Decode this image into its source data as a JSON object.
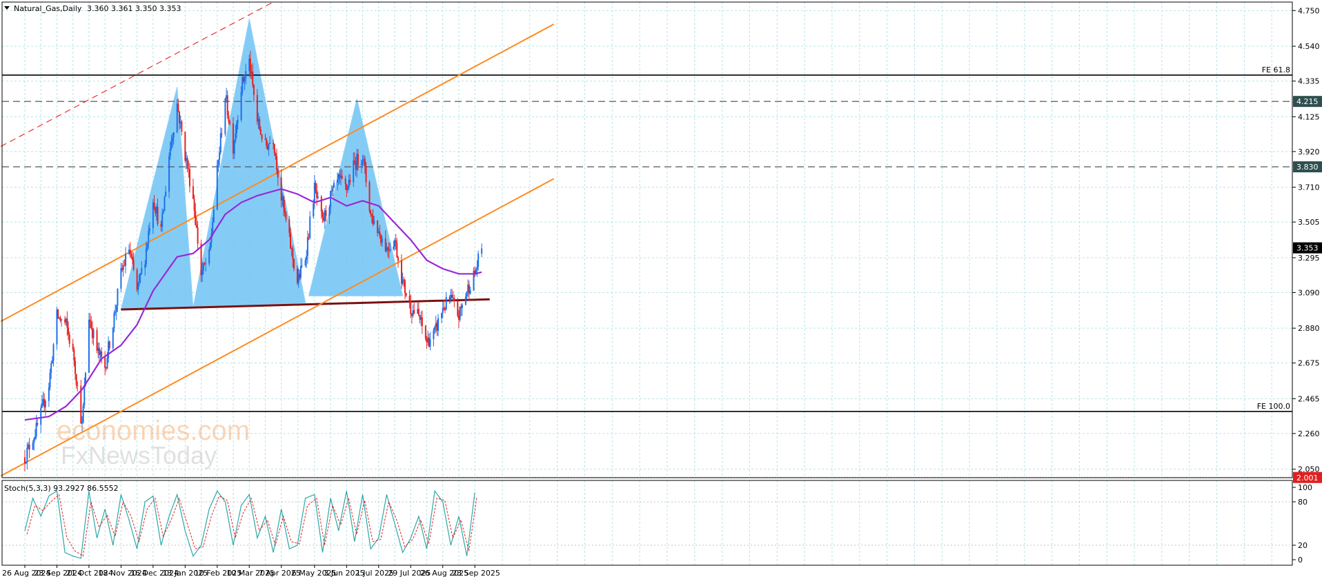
{
  "header": {
    "symbol": "Natural_Gas,Daily",
    "ohlc": "3.360 3.361 3.350 3.353"
  },
  "watermark": {
    "line1": "economies.com",
    "line2": "FxNewsToday"
  },
  "chart_data": {
    "type": "candlestick",
    "price_axis": {
      "ticks": [
        "4.750",
        "4.540",
        "4.335",
        "4.125",
        "3.920",
        "3.710",
        "3.505",
        "3.295",
        "3.090",
        "2.880",
        "2.675",
        "2.465",
        "2.260",
        "2.050"
      ],
      "ylim": [
        2.0,
        4.8
      ]
    },
    "price_tags": [
      {
        "label": "4.215",
        "price": 4.215,
        "style": "dark"
      },
      {
        "label": "3.830",
        "price": 3.83,
        "style": "dark"
      },
      {
        "label": "3.353",
        "price": 3.353,
        "style": "black"
      },
      {
        "label": "2.001",
        "price": 2.001,
        "style": "red"
      }
    ],
    "fib_labels": [
      {
        "label": "FE 61.8",
        "price": 4.37
      },
      {
        "label": "FE 100.0",
        "price": 2.39
      }
    ],
    "date_ticks": [
      {
        "label": "26 Aug 2024",
        "date": "2024-08-26"
      },
      {
        "label": "23 Sep 2024",
        "date": "2024-09-23"
      },
      {
        "label": "21 Oct 2024",
        "date": "2024-10-21"
      },
      {
        "label": "18 Nov 2024",
        "date": "2024-11-18"
      },
      {
        "label": "16 Dec 2024",
        "date": "2024-12-16"
      },
      {
        "label": "13 Jan 2025",
        "date": "2025-01-13"
      },
      {
        "label": "10 Feb 2025",
        "date": "2025-02-10"
      },
      {
        "label": "10 Mar 2025",
        "date": "2025-03-10"
      },
      {
        "label": "7 Apr 2025",
        "date": "2025-04-07"
      },
      {
        "label": "6 May 2025",
        "date": "2025-05-06"
      },
      {
        "label": "3 Jun 2025",
        "date": "2025-06-03"
      },
      {
        "label": "1 Jul 2025",
        "date": "2025-07-01"
      },
      {
        "label": "29 Jul 2025",
        "date": "2025-07-29"
      },
      {
        "label": "26 Aug 2025",
        "date": "2025-08-26"
      },
      {
        "label": "23 Sep 2025",
        "date": "2025-09-23"
      }
    ],
    "close_path": [
      [
        "2024-08-26",
        2.12
      ],
      [
        "2024-09-06",
        2.3
      ],
      [
        "2024-09-16",
        2.55
      ],
      [
        "2024-09-23",
        2.95
      ],
      [
        "2024-10-01",
        2.9
      ],
      [
        "2024-10-08",
        2.7
      ],
      [
        "2024-10-15",
        2.3
      ],
      [
        "2024-10-21",
        2.95
      ],
      [
        "2024-10-28",
        2.75
      ],
      [
        "2024-11-04",
        2.65
      ],
      [
        "2024-11-12",
        2.95
      ],
      [
        "2024-11-18",
        3.2
      ],
      [
        "2024-11-25",
        3.35
      ],
      [
        "2024-12-02",
        3.1
      ],
      [
        "2024-12-09",
        3.3
      ],
      [
        "2024-12-16",
        3.65
      ],
      [
        "2024-12-23",
        3.45
      ],
      [
        "2024-12-30",
        3.9
      ],
      [
        "2025-01-06",
        4.2
      ],
      [
        "2025-01-13",
        3.9
      ],
      [
        "2025-01-20",
        3.65
      ],
      [
        "2025-01-27",
        3.2
      ],
      [
        "2025-02-03",
        3.3
      ],
      [
        "2025-02-10",
        3.8
      ],
      [
        "2025-02-17",
        4.25
      ],
      [
        "2025-02-24",
        3.95
      ],
      [
        "2025-03-03",
        4.3
      ],
      [
        "2025-03-10",
        4.45
      ],
      [
        "2025-03-17",
        4.1
      ],
      [
        "2025-03-24",
        3.95
      ],
      [
        "2025-03-31",
        4.0
      ],
      [
        "2025-04-07",
        3.65
      ],
      [
        "2025-04-14",
        3.4
      ],
      [
        "2025-04-21",
        3.15
      ],
      [
        "2025-04-28",
        3.3
      ],
      [
        "2025-05-06",
        3.7
      ],
      [
        "2025-05-13",
        3.5
      ],
      [
        "2025-05-20",
        3.65
      ],
      [
        "2025-05-27",
        3.75
      ],
      [
        "2025-06-03",
        3.7
      ],
      [
        "2025-06-10",
        3.85
      ],
      [
        "2025-06-17",
        3.9
      ],
      [
        "2025-06-24",
        3.55
      ],
      [
        "2025-07-01",
        3.45
      ],
      [
        "2025-07-08",
        3.35
      ],
      [
        "2025-07-15",
        3.4
      ],
      [
        "2025-07-22",
        3.15
      ],
      [
        "2025-07-29",
        3.0
      ],
      [
        "2025-08-05",
        2.95
      ],
      [
        "2025-08-12",
        2.8
      ],
      [
        "2025-08-19",
        2.85
      ],
      [
        "2025-08-26",
        3.0
      ],
      [
        "2025-09-02",
        3.05
      ],
      [
        "2025-09-09",
        2.95
      ],
      [
        "2025-09-16",
        3.1
      ],
      [
        "2025-09-23",
        3.2
      ],
      [
        "2025-09-29",
        3.35
      ]
    ],
    "moving_average": [
      [
        "2024-08-26",
        2.34
      ],
      [
        "2024-09-16",
        2.36
      ],
      [
        "2024-10-01",
        2.42
      ],
      [
        "2024-10-15",
        2.52
      ],
      [
        "2024-11-01",
        2.7
      ],
      [
        "2024-11-18",
        2.78
      ],
      [
        "2024-12-02",
        2.9
      ],
      [
        "2024-12-16",
        3.1
      ],
      [
        "2025-01-06",
        3.3
      ],
      [
        "2025-01-20",
        3.32
      ],
      [
        "2025-02-03",
        3.4
      ],
      [
        "2025-02-17",
        3.55
      ],
      [
        "2025-03-03",
        3.62
      ],
      [
        "2025-03-17",
        3.66
      ],
      [
        "2025-04-07",
        3.7
      ],
      [
        "2025-04-21",
        3.67
      ],
      [
        "2025-05-06",
        3.62
      ],
      [
        "2025-05-20",
        3.65
      ],
      [
        "2025-06-03",
        3.6
      ],
      [
        "2025-06-17",
        3.63
      ],
      [
        "2025-07-01",
        3.6
      ],
      [
        "2025-07-15",
        3.5
      ],
      [
        "2025-07-29",
        3.4
      ],
      [
        "2025-08-12",
        3.28
      ],
      [
        "2025-08-26",
        3.23
      ],
      [
        "2025-09-09",
        3.2
      ],
      [
        "2025-09-23",
        3.2
      ],
      [
        "2025-09-29",
        3.21
      ]
    ],
    "neckline": [
      [
        "2024-11-18",
        2.99
      ],
      [
        "2025-10-06",
        3.05
      ]
    ],
    "horizontal_levels": [
      {
        "price": 4.37,
        "style": "solid"
      },
      {
        "price": 4.215,
        "style": "dashed"
      },
      {
        "price": 3.83,
        "style": "dashed"
      },
      {
        "price": 2.39,
        "style": "solid"
      },
      {
        "price": 2.001,
        "style": "red-dotted"
      }
    ],
    "trend_lines": [
      {
        "style": "orange",
        "from": [
          "2024-08-05",
          2.92
        ],
        "to": [
          "2025-12-01",
          4.67
        ]
      },
      {
        "style": "orange",
        "from": [
          "2024-08-05",
          2.01
        ],
        "to": [
          "2025-12-01",
          3.76
        ]
      },
      {
        "style": "red-dashed",
        "from": [
          "2024-08-05",
          3.95
        ],
        "to": [
          "2025-03-31",
          4.8
        ]
      }
    ],
    "patterns": [
      {
        "name": "left shoulder",
        "points": [
          [
            "2024-11-18",
            2.99
          ],
          [
            "2025-01-06",
            4.3
          ],
          [
            "2025-01-20",
            3.0
          ]
        ]
      },
      {
        "name": "head",
        "points": [
          [
            "2025-01-20",
            3.0
          ],
          [
            "2025-03-10",
            4.7
          ],
          [
            "2025-04-28",
            3.03
          ]
        ]
      },
      {
        "name": "right shoulder",
        "points": [
          [
            "2025-05-01",
            3.07
          ],
          [
            "2025-06-12",
            4.23
          ],
          [
            "2025-07-22",
            3.07
          ]
        ]
      }
    ],
    "stochastic": {
      "label": "Stoch(5,3,3) 93.2927 86.5552",
      "scale_ticks": [
        "100",
        "80",
        "20",
        "0"
      ],
      "ylim": [
        0,
        100
      ],
      "k": [
        [
          "2024-08-26",
          40
        ],
        [
          "2024-09-02",
          85
        ],
        [
          "2024-09-09",
          60
        ],
        [
          "2024-09-16",
          88
        ],
        [
          "2024-09-23",
          95
        ],
        [
          "2024-09-30",
          10
        ],
        [
          "2024-10-07",
          5
        ],
        [
          "2024-10-14",
          2
        ],
        [
          "2024-10-21",
          95
        ],
        [
          "2024-10-28",
          30
        ],
        [
          "2024-11-04",
          70
        ],
        [
          "2024-11-11",
          20
        ],
        [
          "2024-11-18",
          90
        ],
        [
          "2024-11-25",
          55
        ],
        [
          "2024-12-02",
          15
        ],
        [
          "2024-12-09",
          80
        ],
        [
          "2024-12-16",
          88
        ],
        [
          "2024-12-23",
          20
        ],
        [
          "2024-12-30",
          60
        ],
        [
          "2025-01-06",
          90
        ],
        [
          "2025-01-13",
          40
        ],
        [
          "2025-01-20",
          5
        ],
        [
          "2025-01-27",
          20
        ],
        [
          "2025-02-03",
          70
        ],
        [
          "2025-02-10",
          95
        ],
        [
          "2025-02-17",
          80
        ],
        [
          "2025-02-24",
          20
        ],
        [
          "2025-03-03",
          75
        ],
        [
          "2025-03-10",
          90
        ],
        [
          "2025-03-17",
          30
        ],
        [
          "2025-03-24",
          60
        ],
        [
          "2025-03-31",
          10
        ],
        [
          "2025-04-07",
          70
        ],
        [
          "2025-04-14",
          15
        ],
        [
          "2025-04-21",
          20
        ],
        [
          "2025-04-28",
          85
        ],
        [
          "2025-05-06",
          90
        ],
        [
          "2025-05-13",
          10
        ],
        [
          "2025-05-20",
          85
        ],
        [
          "2025-05-27",
          40
        ],
        [
          "2025-06-03",
          95
        ],
        [
          "2025-06-10",
          25
        ],
        [
          "2025-06-17",
          90
        ],
        [
          "2025-06-24",
          15
        ],
        [
          "2025-07-01",
          30
        ],
        [
          "2025-07-08",
          90
        ],
        [
          "2025-07-15",
          50
        ],
        [
          "2025-07-22",
          10
        ],
        [
          "2025-07-29",
          30
        ],
        [
          "2025-08-05",
          60
        ],
        [
          "2025-08-12",
          15
        ],
        [
          "2025-08-19",
          95
        ],
        [
          "2025-08-26",
          80
        ],
        [
          "2025-09-02",
          20
        ],
        [
          "2025-09-09",
          60
        ],
        [
          "2025-09-16",
          5
        ],
        [
          "2025-09-23",
          93
        ]
      ],
      "d": [
        [
          "2024-08-26",
          35
        ],
        [
          "2024-09-02",
          75
        ],
        [
          "2024-09-09",
          68
        ],
        [
          "2024-09-16",
          80
        ],
        [
          "2024-09-23",
          90
        ],
        [
          "2024-09-30",
          30
        ],
        [
          "2024-10-07",
          12
        ],
        [
          "2024-10-14",
          5
        ],
        [
          "2024-10-21",
          80
        ],
        [
          "2024-10-28",
          45
        ],
        [
          "2024-11-04",
          62
        ],
        [
          "2024-11-11",
          32
        ],
        [
          "2024-11-18",
          80
        ],
        [
          "2024-11-25",
          60
        ],
        [
          "2024-12-02",
          25
        ],
        [
          "2024-12-09",
          70
        ],
        [
          "2024-12-16",
          85
        ],
        [
          "2024-12-23",
          32
        ],
        [
          "2024-12-30",
          55
        ],
        [
          "2025-01-06",
          85
        ],
        [
          "2025-01-13",
          50
        ],
        [
          "2025-01-20",
          15
        ],
        [
          "2025-01-27",
          18
        ],
        [
          "2025-02-03",
          60
        ],
        [
          "2025-02-10",
          88
        ],
        [
          "2025-02-17",
          82
        ],
        [
          "2025-02-24",
          30
        ],
        [
          "2025-03-03",
          65
        ],
        [
          "2025-03-10",
          85
        ],
        [
          "2025-03-17",
          40
        ],
        [
          "2025-03-24",
          55
        ],
        [
          "2025-03-31",
          20
        ],
        [
          "2025-04-07",
          60
        ],
        [
          "2025-04-14",
          25
        ],
        [
          "2025-04-21",
          22
        ],
        [
          "2025-04-28",
          75
        ],
        [
          "2025-05-06",
          85
        ],
        [
          "2025-05-13",
          20
        ],
        [
          "2025-05-20",
          75
        ],
        [
          "2025-05-27",
          48
        ],
        [
          "2025-06-03",
          85
        ],
        [
          "2025-06-10",
          35
        ],
        [
          "2025-06-17",
          82
        ],
        [
          "2025-06-24",
          25
        ],
        [
          "2025-07-01",
          28
        ],
        [
          "2025-07-08",
          80
        ],
        [
          "2025-07-15",
          55
        ],
        [
          "2025-07-22",
          18
        ],
        [
          "2025-07-29",
          28
        ],
        [
          "2025-08-05",
          55
        ],
        [
          "2025-08-12",
          22
        ],
        [
          "2025-08-19",
          85
        ],
        [
          "2025-08-26",
          82
        ],
        [
          "2025-09-02",
          30
        ],
        [
          "2025-09-09",
          55
        ],
        [
          "2025-09-16",
          12
        ],
        [
          "2025-09-23",
          87
        ]
      ]
    }
  }
}
